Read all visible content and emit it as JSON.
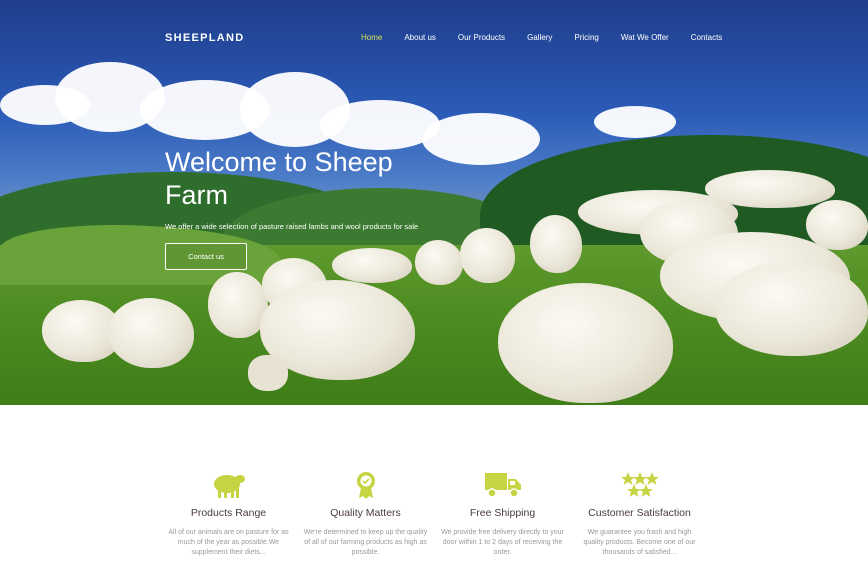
{
  "brand": "SHEEPLAND",
  "nav": {
    "items": [
      {
        "label": "Home",
        "active": true
      },
      {
        "label": "About us"
      },
      {
        "label": "Our Products"
      },
      {
        "label": "Gallery"
      },
      {
        "label": "Pricing"
      },
      {
        "label": "Wat We Offer"
      },
      {
        "label": "Contacts"
      }
    ]
  },
  "hero": {
    "title": "Welcome to Sheep Farm",
    "subtitle": "We offer a wide selection of pasture raised lambs and wool products for sale",
    "button": "Contact us"
  },
  "features": [
    {
      "icon": "sheep-icon",
      "title": "Products Range",
      "desc": "All of our animals are on pasture for as much of the year as possible.We supplement their diets..."
    },
    {
      "icon": "award-badge-icon",
      "title": "Quality Matters",
      "desc": "We're determined to keep up the quality of all of our farming products as high as possible."
    },
    {
      "icon": "truck-icon",
      "title": "Free Shipping",
      "desc": "We provide free delivery directly to your door within 1 to 2 days of receiving the order."
    },
    {
      "icon": "stars-icon",
      "title": "Customer Satisfaction",
      "desc": "We guarantee you frash and high quality products. Become one of our thousands of satisfied..."
    }
  ],
  "colors": {
    "accent": "#c6d444",
    "nav_active": "#d4e157",
    "feature_title": "#4a3b3b"
  }
}
